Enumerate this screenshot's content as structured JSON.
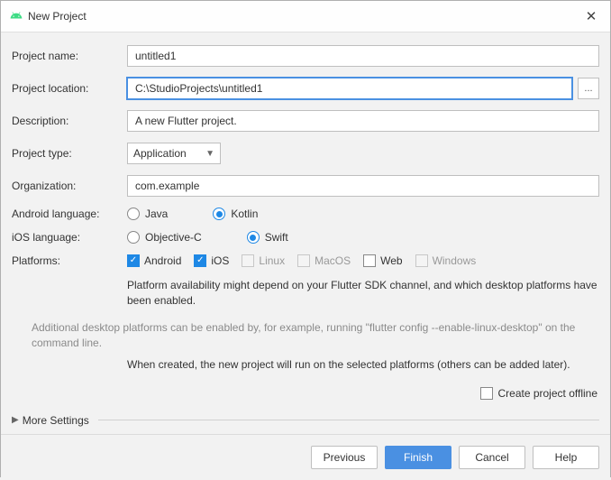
{
  "title": "New Project",
  "form": {
    "project_name": {
      "label": "Project name:",
      "value": "untitled1"
    },
    "project_location": {
      "label": "Project location:",
      "value": "C:\\StudioProjects\\untitled1"
    },
    "description": {
      "label": "Description:",
      "value": "A new Flutter project."
    },
    "project_type": {
      "label": "Project type:",
      "value": "Application"
    },
    "organization": {
      "label": "Organization:",
      "value": "com.example"
    },
    "android_language": {
      "label": "Android language:",
      "options": [
        {
          "label": "Java",
          "selected": false
        },
        {
          "label": "Kotlin",
          "selected": true
        }
      ]
    },
    "ios_language": {
      "label": "iOS language:",
      "options": [
        {
          "label": "Objective-C",
          "selected": false
        },
        {
          "label": "Swift",
          "selected": true
        }
      ]
    },
    "platforms": {
      "label": "Platforms:",
      "options": [
        {
          "label": "Android",
          "checked": true,
          "enabled": true
        },
        {
          "label": "iOS",
          "checked": true,
          "enabled": true
        },
        {
          "label": "Linux",
          "checked": false,
          "enabled": false
        },
        {
          "label": "MacOS",
          "checked": false,
          "enabled": false
        },
        {
          "label": "Web",
          "checked": false,
          "enabled": true
        },
        {
          "label": "Windows",
          "checked": false,
          "enabled": false
        }
      ]
    }
  },
  "info": {
    "availability": "Platform availability might depend on your Flutter SDK channel, and which desktop platforms have been enabled.",
    "additional": "Additional desktop platforms can be enabled by, for example, running \"flutter config --enable-linux-desktop\" on the command line.",
    "created": "When created, the new project will run on the selected platforms (others can be added later)."
  },
  "offline": {
    "label": "Create project offline",
    "checked": false
  },
  "more_settings": "More Settings",
  "buttons": {
    "previous": "Previous",
    "finish": "Finish",
    "cancel": "Cancel",
    "help": "Help"
  },
  "browse": "..."
}
